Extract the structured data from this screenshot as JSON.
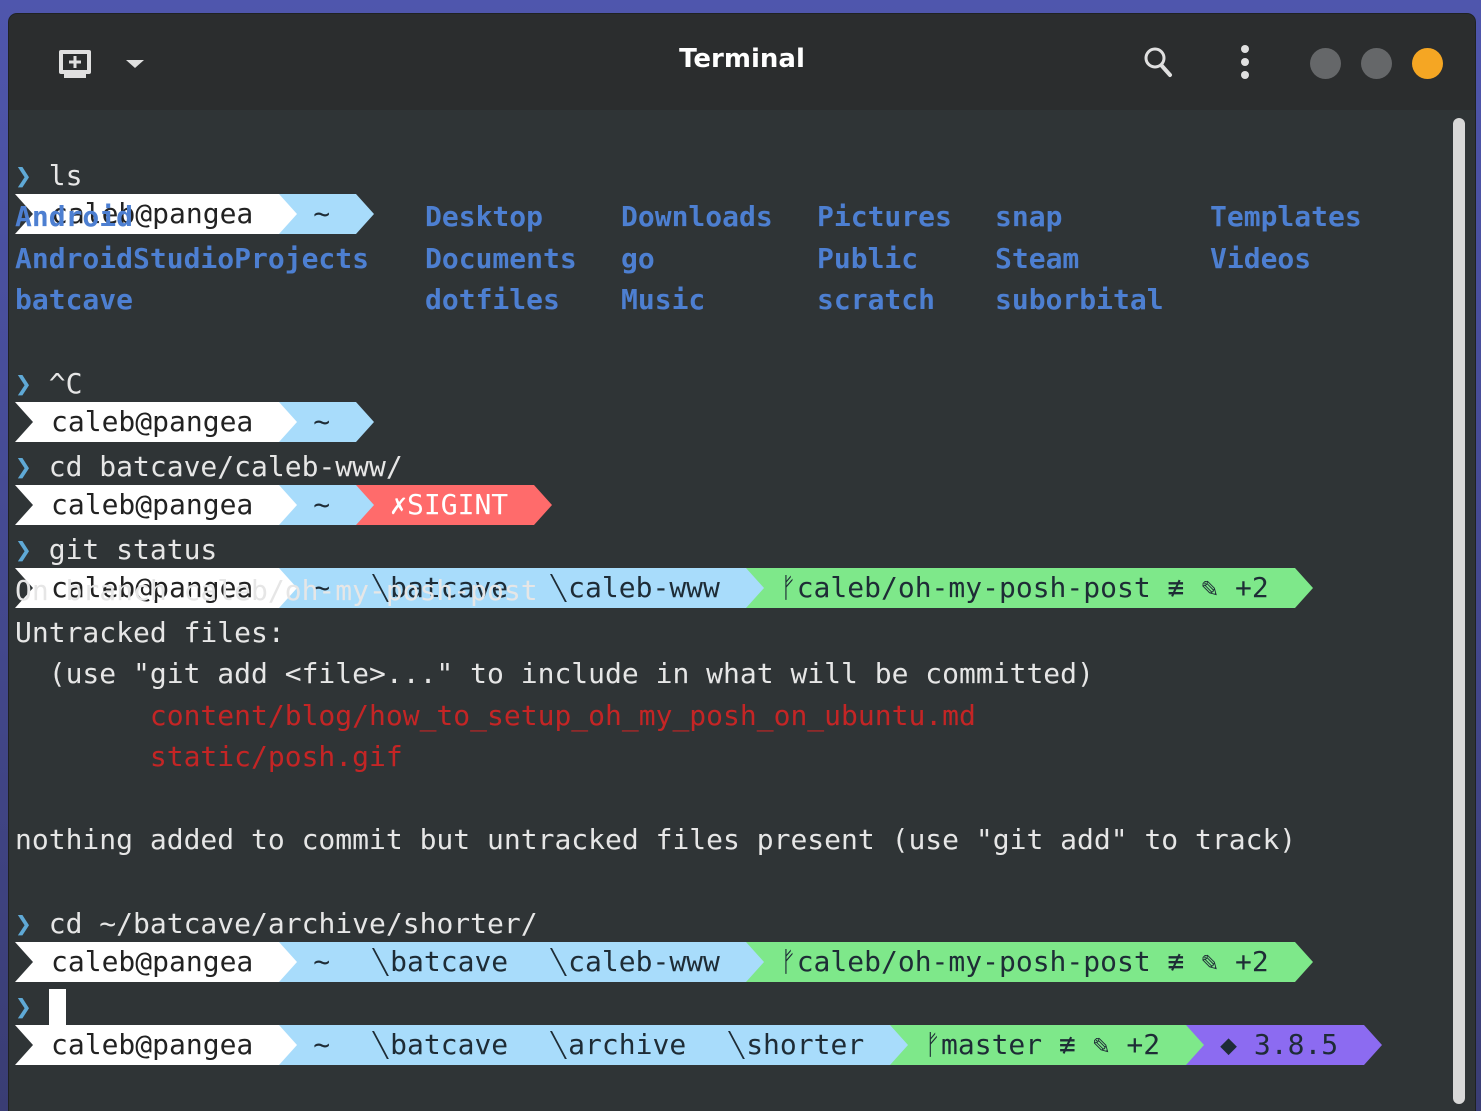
{
  "window": {
    "title": "Terminal"
  },
  "toolbar": {
    "new_tab_icon": "terminal-new-tab-icon",
    "dropdown_icon": "chevron-down-icon",
    "search_icon": "search-icon",
    "menu_icon": "kebab-menu-icon"
  },
  "colors": {
    "accent_close": "#f5a623",
    "segment_blue": "#a8dcfb",
    "segment_green": "#7ee88a",
    "segment_red": "#ff6b6b",
    "segment_purple": "#8c6bf1",
    "directory_blue": "#4d7fd1",
    "untracked_red": "#c42525"
  },
  "terminal": {
    "p1": {
      "user": "caleb@pangea",
      "home": "~"
    },
    "cmd1": "ls",
    "ls_cols": [
      [
        "Android",
        "AndroidStudioProjects",
        "batcave"
      ],
      [
        "Desktop",
        "Documents",
        "dotfiles"
      ],
      [
        "Downloads",
        "go",
        "Music"
      ],
      [
        "Pictures",
        "Public",
        "scratch"
      ],
      [
        "snap",
        "Steam",
        "suborbital"
      ],
      [
        "Templates",
        "Videos",
        ""
      ]
    ],
    "p2": {
      "user": "caleb@pangea",
      "home": "~"
    },
    "cmd2": "^C",
    "p3": {
      "user": "caleb@pangea",
      "home": "~",
      "signal": "✗SIGINT"
    },
    "cmd3": "cd batcave/caleb-www/",
    "p4": {
      "user": "caleb@pangea",
      "home": "~",
      "d1": "batcave",
      "d2": "caleb-www",
      "git": "ᚠcaleb/oh-my-posh-post ≢ ✎ +2"
    },
    "cmd4": "git status",
    "out1": "On branch caleb/oh-my-posh-post",
    "out2": "Untracked files:",
    "out3": "  (use \"git add <file>...\" to include in what will be committed)",
    "out4": "        content/blog/how_to_setup_oh_my_posh_on_ubuntu.md",
    "out5": "        static/posh.gif",
    "out6": "nothing added to commit but untracked files present (use \"git add\" to track)",
    "p5": {
      "user": "caleb@pangea",
      "home": "~",
      "d1": "batcave",
      "d2": "caleb-www",
      "git": "ᚠcaleb/oh-my-posh-post ≢ ✎ +2"
    },
    "cmd5": "cd ~/batcave/archive/shorter/",
    "p6": {
      "user": "caleb@pangea",
      "home": "~",
      "d1": "batcave",
      "d2": "archive",
      "d3": "shorter",
      "git": "ᚠmaster ≢ ✎ +2",
      "python": "◆ 3.8.5"
    },
    "caret": "❯"
  }
}
